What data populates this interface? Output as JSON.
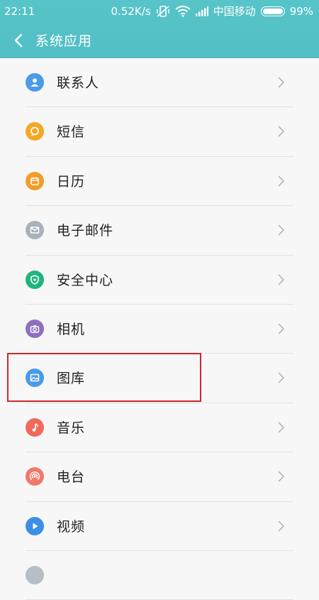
{
  "status_bar": {
    "time": "22:11",
    "network_speed": "0.52K/s",
    "carrier": "中国移动",
    "battery": "99%"
  },
  "header": {
    "title": "系统应用",
    "background_color": "#54c2c6"
  },
  "items": [
    {
      "label": "联系人",
      "icon": "contact-icon",
      "color": "#4a9be8"
    },
    {
      "label": "短信",
      "icon": "message-icon",
      "color": "#f5a623"
    },
    {
      "label": "日历",
      "icon": "calendar-icon",
      "color": "#f39c2a"
    },
    {
      "label": "电子邮件",
      "icon": "mail-icon",
      "color": "#a9b1bb"
    },
    {
      "label": "安全中心",
      "icon": "shield-icon",
      "color": "#1fb57e"
    },
    {
      "label": "相机",
      "icon": "camera-icon",
      "color": "#8e6fc0"
    },
    {
      "label": "图库",
      "icon": "gallery-icon",
      "color": "#4a9be8"
    },
    {
      "label": "音乐",
      "icon": "music-icon",
      "color": "#f06a5a"
    },
    {
      "label": "电台",
      "icon": "radio-icon",
      "color": "#f07a6a"
    },
    {
      "label": "视频",
      "icon": "video-icon",
      "color": "#3b8fe6"
    },
    {
      "label": "",
      "icon": "item-icon",
      "color": "#b8bec6"
    }
  ],
  "highlight_color": "#d0272f"
}
